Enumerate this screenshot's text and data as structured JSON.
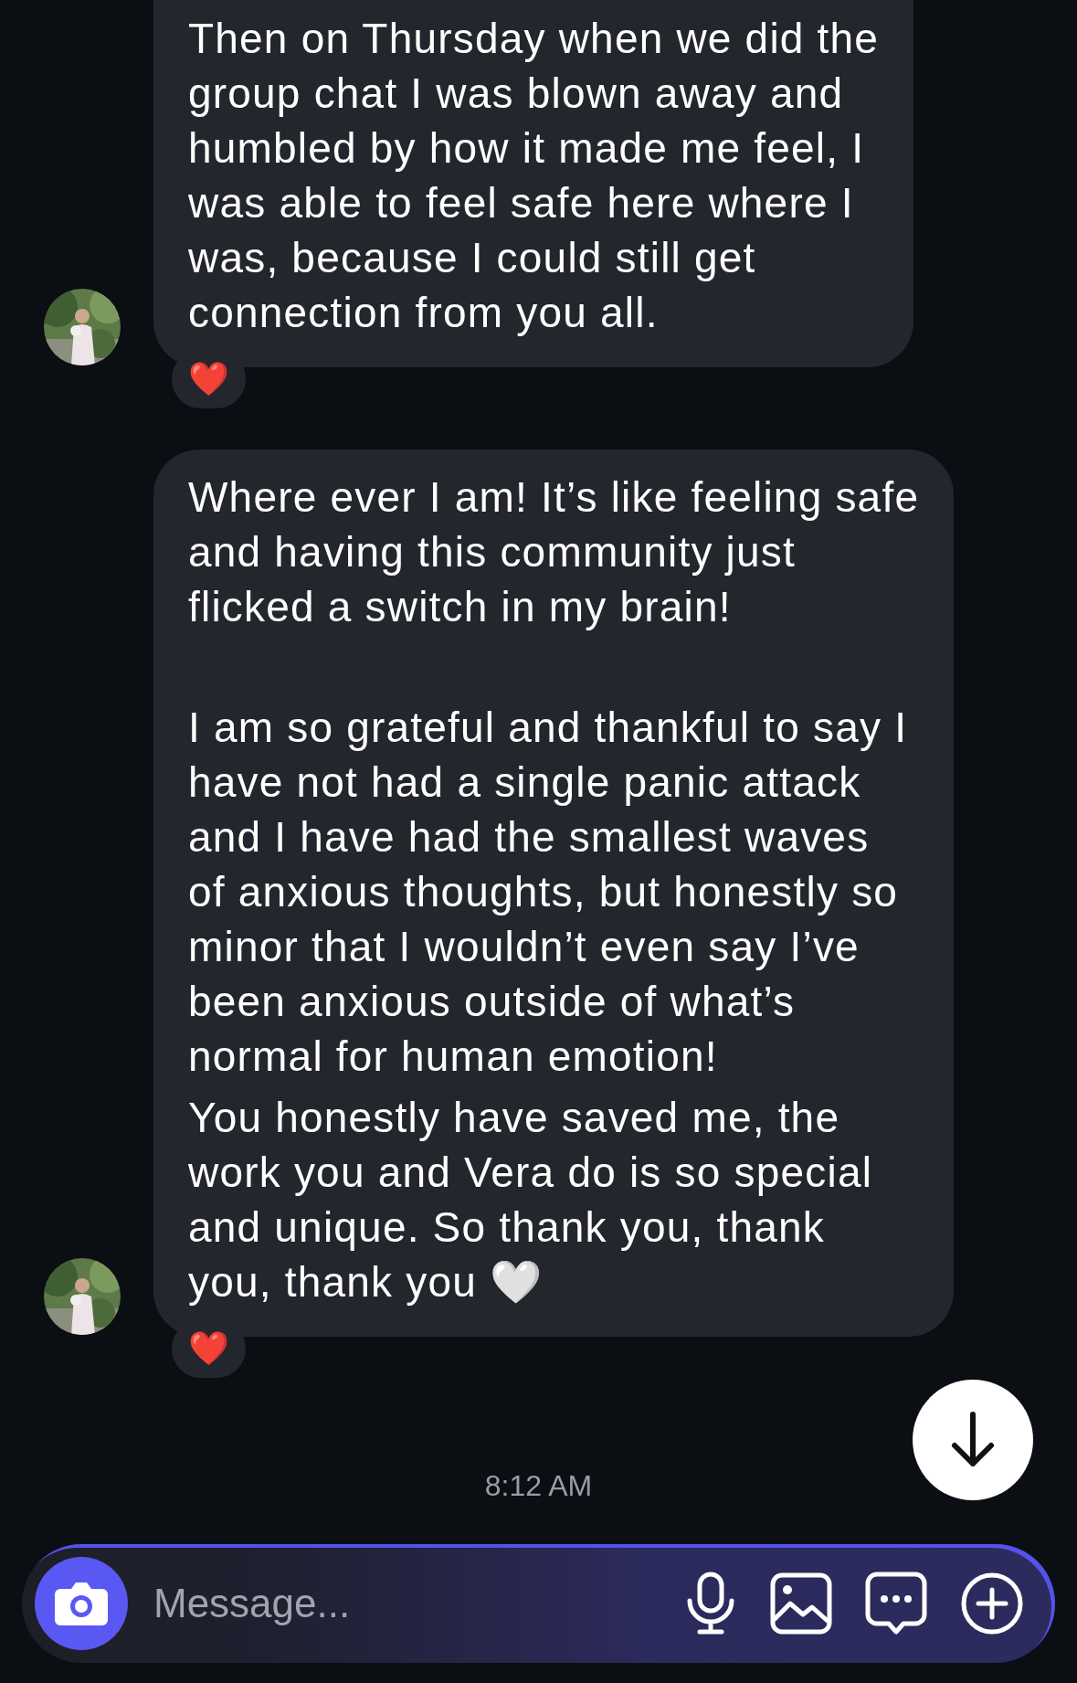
{
  "messages": [
    {
      "paragraphs": [
        "Then on Thursday when we did the\ngroup chat I was blown away and\nhumbled by how it made me feel, I\nwas able to feel safe here where I\nwas, because I could still get\nconnection from you all."
      ],
      "continued": true,
      "avatar": {
        "kind": "picture"
      },
      "reaction": "❤️"
    },
    {
      "paragraphs": [
        "Where ever I am! It’s like feeling safe\nand having this community just\nflicked a switch in my brain!",
        "I am so grateful and thankful to say I\nhave not had a single panic attack\nand I have had the smallest waves\nof anxious thoughts, but honestly so\nminor that I wouldn’t even say I’ve\nbeen anxious outside of what’s\nnormal for human emotion!",
        "You honestly have saved me, the\nwork you and Vera do is so special\nand unique. So thank you, thank\nyou, thank you 🤍"
      ],
      "continued": false,
      "avatar": {
        "kind": "picture"
      },
      "reaction": "❤️"
    }
  ],
  "timestamp": "8:12 AM",
  "composer": {
    "placeholder": "Message..."
  }
}
